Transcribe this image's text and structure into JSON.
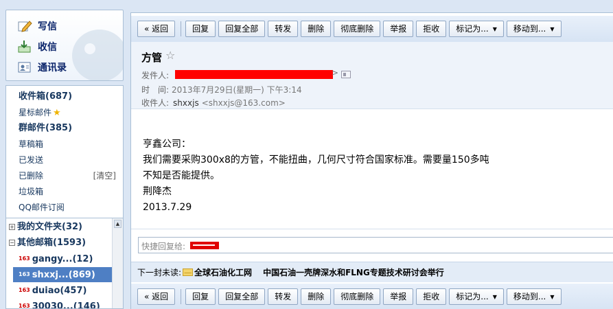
{
  "quick_actions": {
    "write": "写信",
    "receive": "收信",
    "contacts": "通讯录"
  },
  "folders": {
    "inbox": "收件箱(687)",
    "starred": "星标邮件",
    "group": "群邮件(385)",
    "drafts": "草稿箱",
    "sent": "已发送",
    "deleted": "已删除",
    "clear": "[清空]",
    "spam": "垃圾箱",
    "qq_subscription": "QQ邮件订阅"
  },
  "tree": {
    "my_folders": "我的文件夹(32)",
    "other_mailboxes": "其他邮箱(1593)",
    "accounts": [
      {
        "badge": "163",
        "label": "gangy...(12)"
      },
      {
        "badge": "163",
        "label": "shxxj...(869)"
      },
      {
        "badge": "163",
        "label": "duiao(457)"
      },
      {
        "badge": "163",
        "label": "30030...(146)"
      }
    ]
  },
  "toolbar": {
    "back": "« 返回",
    "reply": "回复",
    "reply_all": "回复全部",
    "forward": "转发",
    "delete": "删除",
    "delete_permanent": "彻底删除",
    "report": "举报",
    "reject": "拒收",
    "mark_as": "标记为...",
    "move_to": "移动到...",
    "dropdown_glyph": "▼"
  },
  "email": {
    "subject": "方管",
    "star_glyph": "☆",
    "from_label": "发件人:",
    "time_label": "时　间:",
    "time_value": "2013年7月29日(星期一) 下午3:14",
    "to_label": "收件人:",
    "to_name": "shxxjs",
    "to_address": "<shxxjs@163.com>",
    "body_lines": [
      "亨鑫公司：",
      "我们需要采购300x8的方管，不能扭曲，几何尺寸符合国家标准。需要量150多吨",
      "不知是否能提供。",
      "荆降杰",
      "2013.7.29"
    ]
  },
  "quick_reply": {
    "label": "快捷回复给:"
  },
  "next_unread": {
    "label": "下一封未读:",
    "sender": "全球石油化工网",
    "subject": "中国石油一壳牌深水和FLNG专题技术研讨会举行"
  }
}
